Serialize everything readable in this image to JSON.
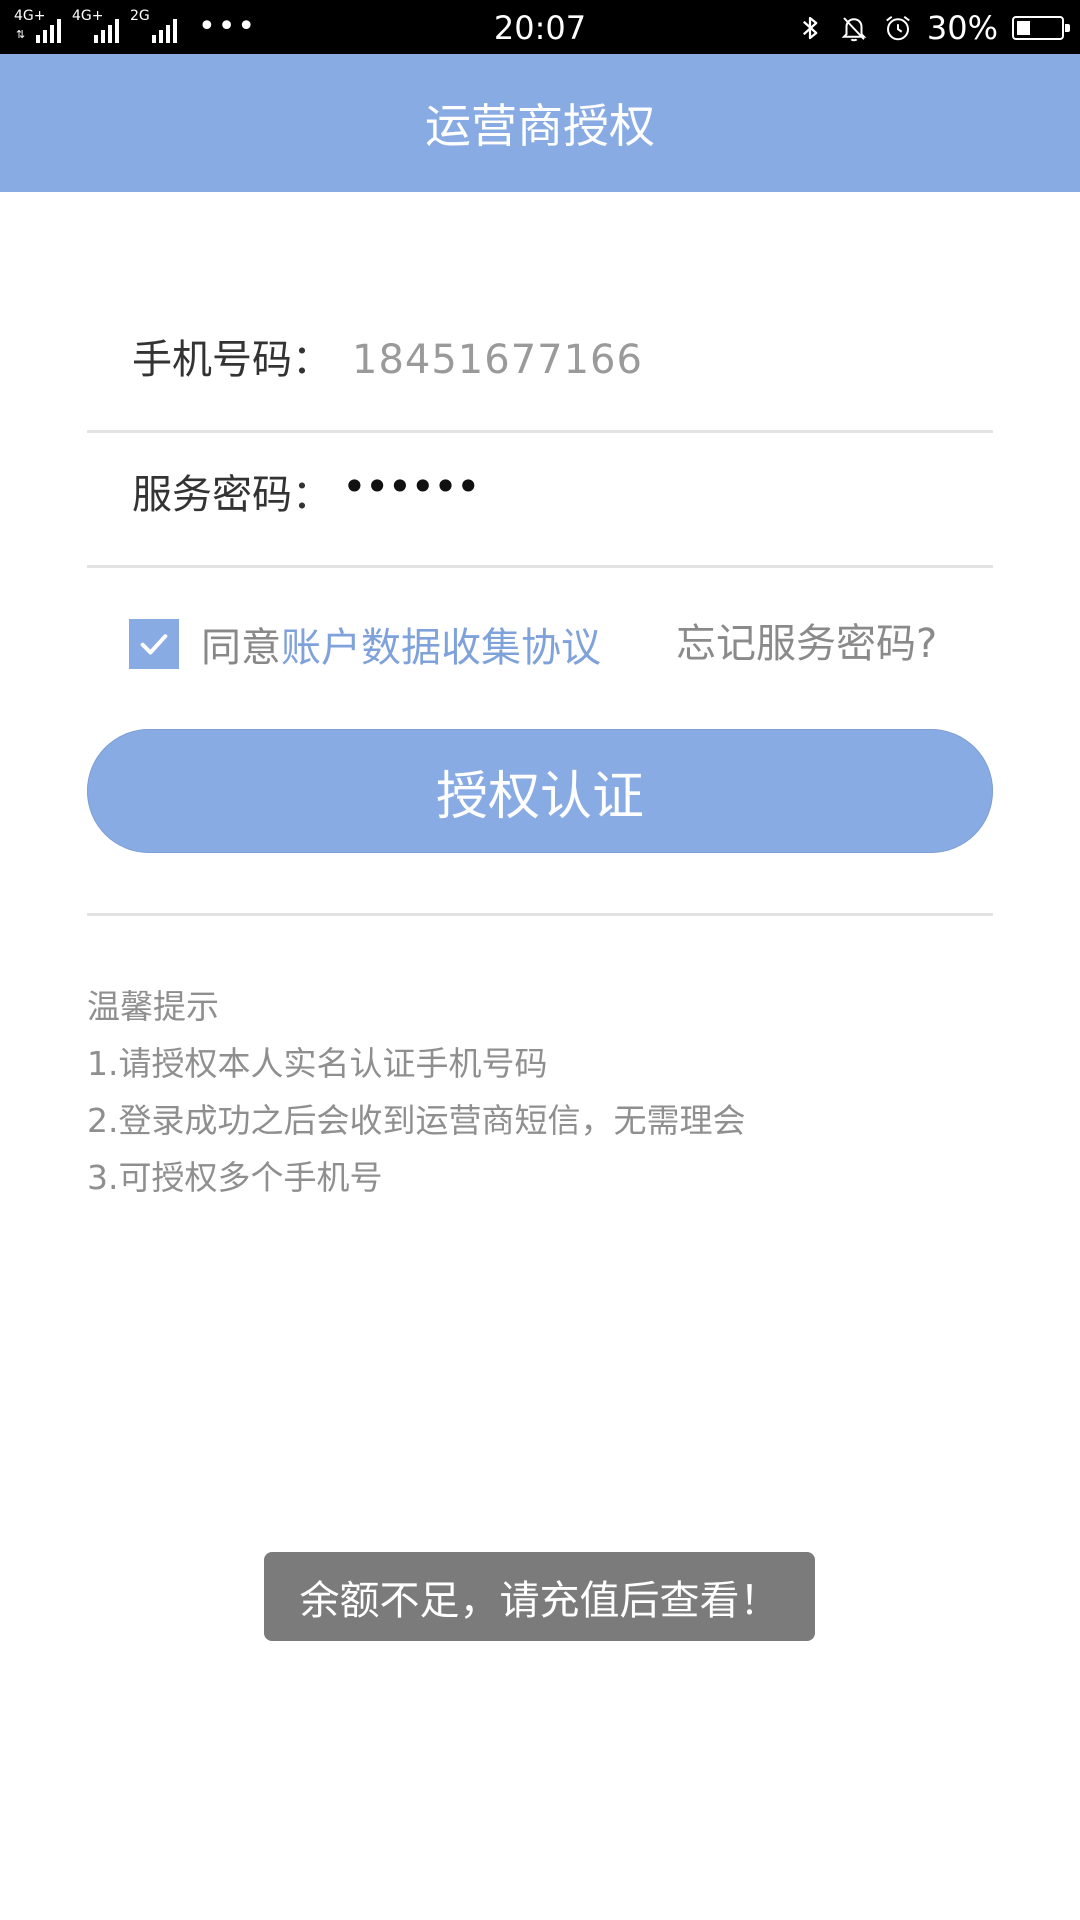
{
  "status_bar": {
    "network_1": "4G+",
    "network_2": "4G+",
    "network_3": "2G",
    "dots": "•••",
    "time": "20:07",
    "battery_text": "30%",
    "battery_level": 0.3,
    "icons": [
      "bluetooth-icon",
      "bell-off-icon",
      "alarm-icon",
      "battery-icon"
    ]
  },
  "header": {
    "title": "运营商授权"
  },
  "form": {
    "phone_label": "手机号码：",
    "phone_value": "18451677166",
    "password_label": "服务密码：",
    "password_value": "••••••"
  },
  "agreement": {
    "checked": true,
    "prefix": "同意",
    "link": "账户数据收集协议",
    "forgot": "忘记服务密码?"
  },
  "submit_button": "授权认证",
  "tips": {
    "title": "温馨提示",
    "items": [
      "1.请授权本人实名认证手机号码",
      "2.登录成功之后会收到运营商短信，无需理会",
      "3.可授权多个手机号"
    ]
  },
  "toast": "余额不足，请充值后查看！",
  "colors": {
    "primary": "#89abe3",
    "link": "#7fa2db",
    "toast_bg": "#7b7b7b"
  }
}
